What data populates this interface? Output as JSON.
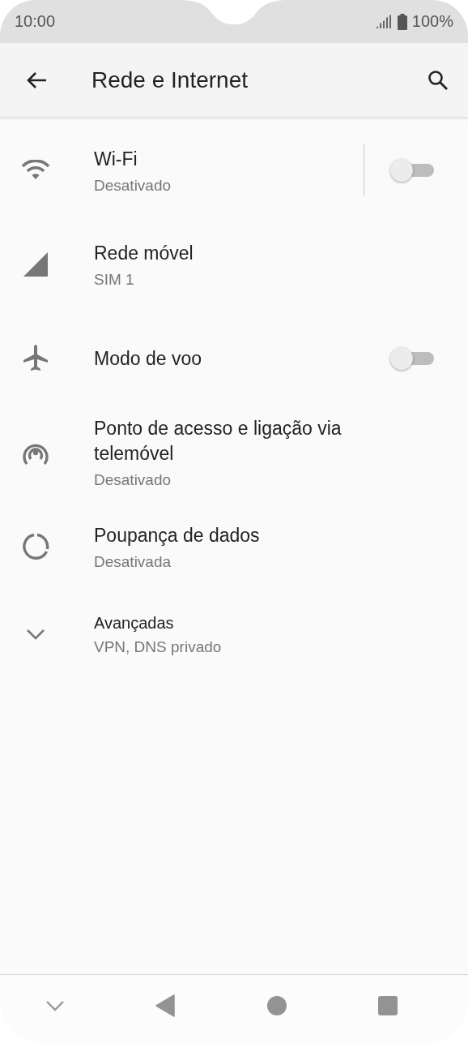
{
  "status_bar": {
    "time": "10:00",
    "battery": "100%"
  },
  "app_bar": {
    "title": "Rede e Internet"
  },
  "rows": [
    {
      "kind": "split_switch",
      "title": "Wi-Fi",
      "subtitle": "Desativado",
      "on": false
    },
    {
      "kind": "link",
      "title": "Rede móvel",
      "subtitle": "SIM 1"
    },
    {
      "kind": "switch",
      "title": "Modo de voo",
      "on": false
    },
    {
      "kind": "link",
      "title": "Ponto de acesso e ligação via telemóvel",
      "subtitle": "Desativado"
    },
    {
      "kind": "link",
      "title": "Poupança de dados",
      "subtitle": "Desativada"
    },
    {
      "kind": "expander",
      "title": "Avançadas",
      "subtitle": "VPN, DNS privado"
    }
  ]
}
